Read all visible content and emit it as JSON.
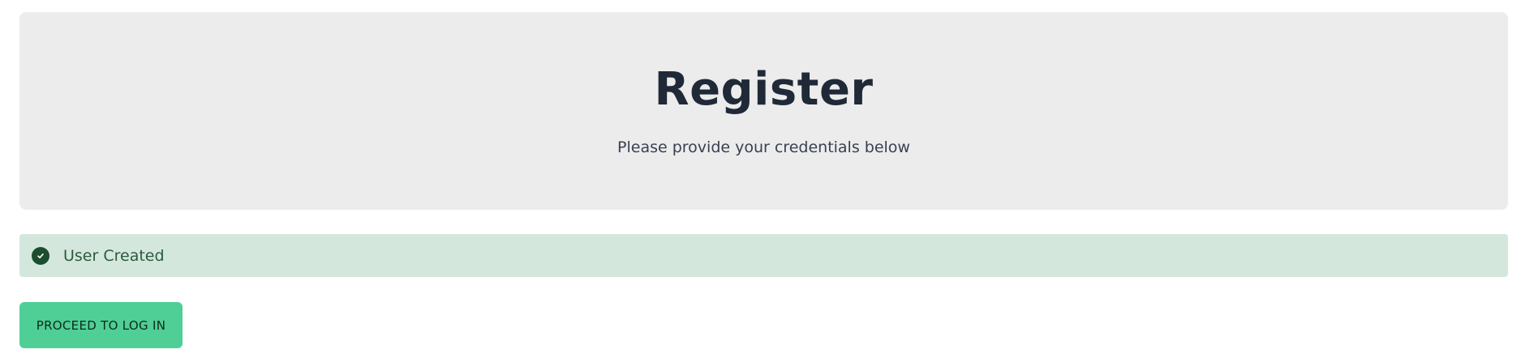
{
  "hero": {
    "title": "Register",
    "subtitle": "Please provide your credentials below",
    "background": "#ececec"
  },
  "alert": {
    "message": "User Created",
    "icon": "check-circle-icon",
    "background": "#d4e7dd",
    "icon_color": "#1d4d2f"
  },
  "actions": {
    "proceed_label": "PROCEED TO LOG IN",
    "proceed_color": "#4fcf95"
  }
}
